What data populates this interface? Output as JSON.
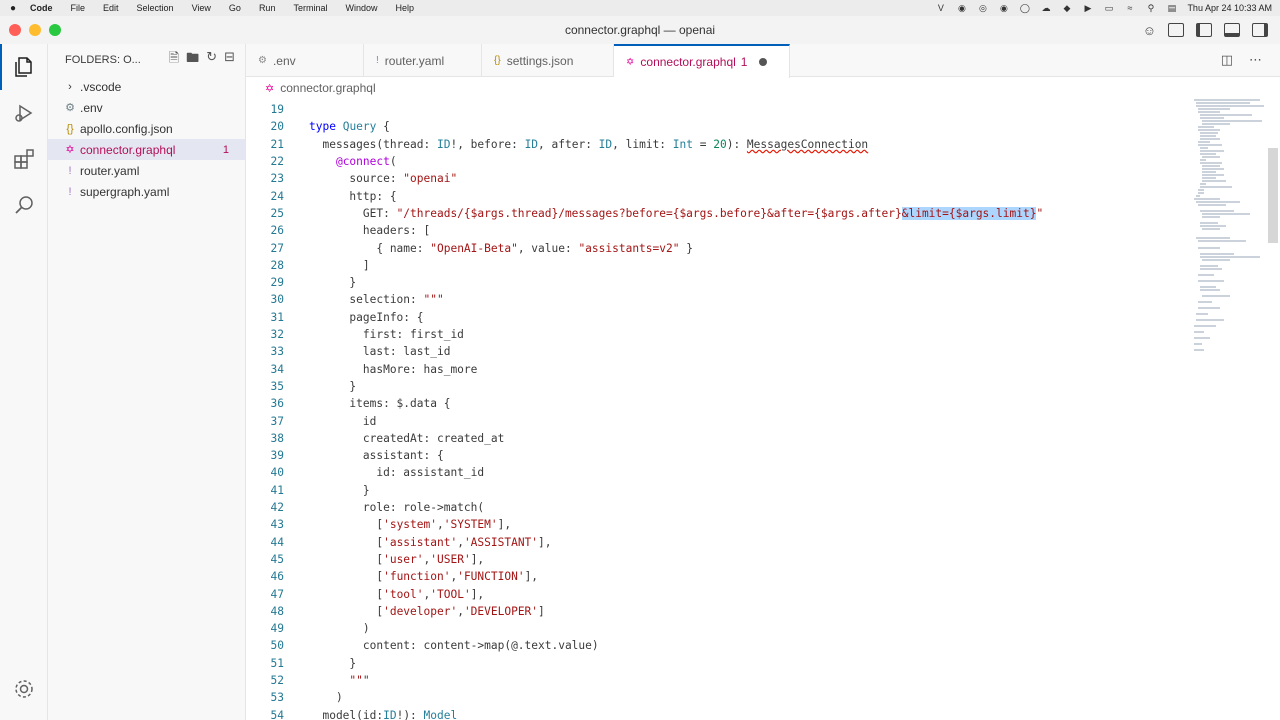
{
  "menubar": {
    "app": "Code",
    "items": [
      "File",
      "Edit",
      "Selection",
      "View",
      "Go",
      "Run",
      "Terminal",
      "Window",
      "Help"
    ],
    "clock": "Thu Apr 24  10:33 AM"
  },
  "window": {
    "title": "connector.graphql — openai"
  },
  "sidebar": {
    "header": "FOLDERS: O...",
    "items": [
      {
        "label": ".vscode",
        "icon": "chevron-right-icon",
        "badge": ""
      },
      {
        "label": ".env",
        "icon": "gear-icon",
        "badge": ""
      },
      {
        "label": "apollo.config.json",
        "icon": "json-braces-icon",
        "badge": ""
      },
      {
        "label": "connector.graphql",
        "icon": "graphql-icon",
        "badge": "1"
      },
      {
        "label": "router.yaml",
        "icon": "yaml-icon",
        "badge": ""
      },
      {
        "label": "supergraph.yaml",
        "icon": "yaml-icon",
        "badge": ""
      }
    ]
  },
  "tabs": [
    {
      "label": ".env",
      "icon": "gear-icon",
      "active": false,
      "badge": ""
    },
    {
      "label": "router.yaml",
      "icon": "yaml-icon",
      "active": false,
      "badge": ""
    },
    {
      "label": "settings.json",
      "icon": "json-braces-icon",
      "active": false,
      "badge": ""
    },
    {
      "label": "connector.graphql",
      "icon": "graphql-icon",
      "active": true,
      "badge": "1"
    }
  ],
  "breadcrumb": {
    "file": "connector.graphql"
  },
  "editor": {
    "lines": [
      {
        "n": "19",
        "text": ""
      },
      {
        "n": "20",
        "text": "type Query {"
      },
      {
        "n": "21",
        "text": "  messages(thread: ID!, before: ID, after: ID, limit: Int = 20): MessagesConnection"
      },
      {
        "n": "22",
        "text": "    @connect("
      },
      {
        "n": "23",
        "text": "      source: \"openai\""
      },
      {
        "n": "24",
        "text": "      http: {"
      },
      {
        "n": "25",
        "text": "        GET: \"/threads/{$args.thread}/messages?before={$args.before}&after={$args.after}&limit={$args.limit}\""
      },
      {
        "n": "26",
        "text": "        headers: ["
      },
      {
        "n": "27",
        "text": "          { name: \"OpenAI-Beta\", value: \"assistants=v2\" }"
      },
      {
        "n": "28",
        "text": "        ]"
      },
      {
        "n": "29",
        "text": "      }"
      },
      {
        "n": "30",
        "text": "      selection: \"\"\""
      },
      {
        "n": "31",
        "text": "      pageInfo: {"
      },
      {
        "n": "32",
        "text": "        first: first_id"
      },
      {
        "n": "33",
        "text": "        last: last_id"
      },
      {
        "n": "34",
        "text": "        hasMore: has_more"
      },
      {
        "n": "35",
        "text": "      }"
      },
      {
        "n": "36",
        "text": "      items: $.data {"
      },
      {
        "n": "37",
        "text": "        id"
      },
      {
        "n": "38",
        "text": "        createdAt: created_at"
      },
      {
        "n": "39",
        "text": "        assistant: {"
      },
      {
        "n": "40",
        "text": "          id: assistant_id"
      },
      {
        "n": "41",
        "text": "        }"
      },
      {
        "n": "42",
        "text": "        role: role->match("
      },
      {
        "n": "43",
        "text": "          ['system','SYSTEM'],"
      },
      {
        "n": "44",
        "text": "          ['assistant','ASSISTANT'],"
      },
      {
        "n": "45",
        "text": "          ['user','USER'],"
      },
      {
        "n": "46",
        "text": "          ['function','FUNCTION'],"
      },
      {
        "n": "47",
        "text": "          ['tool','TOOL'],"
      },
      {
        "n": "48",
        "text": "          ['developer','DEVELOPER']"
      },
      {
        "n": "49",
        "text": "        )"
      },
      {
        "n": "50",
        "text": "        content: content->map(@.text.value)"
      },
      {
        "n": "51",
        "text": "      }"
      },
      {
        "n": "52",
        "text": "      \"\"\""
      },
      {
        "n": "53",
        "text": "    )"
      },
      {
        "n": "54",
        "text": "  model(id:ID!): Model"
      }
    ],
    "selected_text": "&limit={$args.limit}"
  },
  "colors": {
    "accent": "#005fb8",
    "graphql": "#e10098",
    "active_tab_text": "#b30f5b",
    "selection": "#add6ff",
    "line_number": "#237893"
  }
}
